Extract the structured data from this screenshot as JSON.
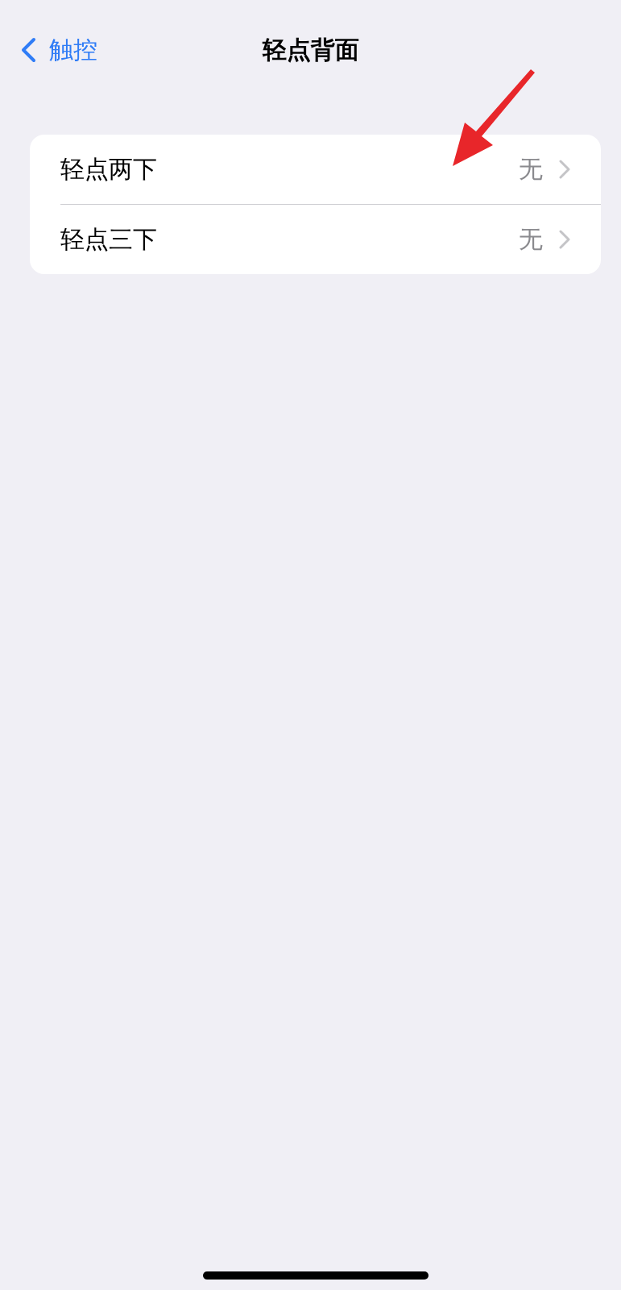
{
  "nav": {
    "back_label": "触控",
    "title": "轻点背面"
  },
  "settings": [
    {
      "label": "轻点两下",
      "value": "无"
    },
    {
      "label": "轻点三下",
      "value": "无"
    }
  ]
}
